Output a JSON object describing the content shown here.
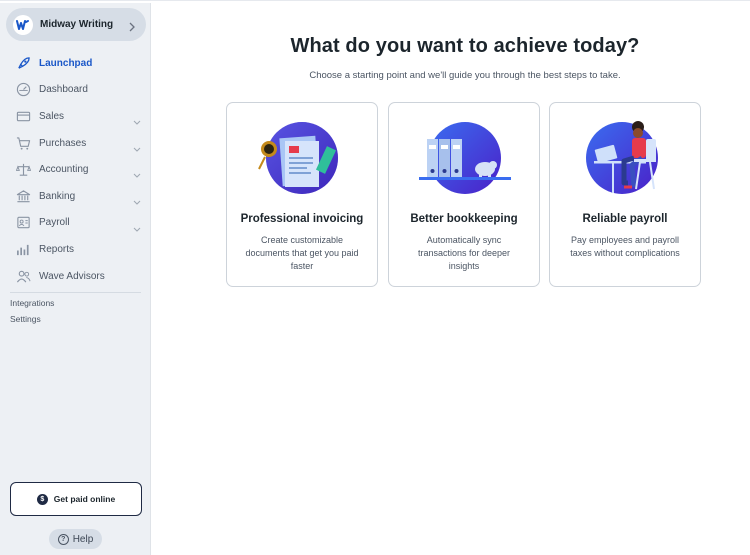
{
  "sidebar": {
    "business_name": "Midway Writing",
    "nav": [
      {
        "label": "Launchpad",
        "icon": "rocket-icon",
        "active": true,
        "caret": false
      },
      {
        "label": "Dashboard",
        "icon": "dashboard-icon",
        "active": false,
        "caret": false
      },
      {
        "label": "Sales",
        "icon": "sales-icon",
        "active": false,
        "caret": true
      },
      {
        "label": "Purchases",
        "icon": "purchases-icon",
        "active": false,
        "caret": true
      },
      {
        "label": "Accounting",
        "icon": "scales-icon",
        "active": false,
        "caret": true
      },
      {
        "label": "Banking",
        "icon": "bank-icon",
        "active": false,
        "caret": true
      },
      {
        "label": "Payroll",
        "icon": "payroll-icon",
        "active": false,
        "caret": true
      },
      {
        "label": "Reports",
        "icon": "bar-chart-icon",
        "active": false,
        "caret": false
      },
      {
        "label": "Wave Advisors",
        "icon": "advisors-icon",
        "active": false,
        "caret": false
      }
    ],
    "integrations": "Integrations",
    "settings": "Settings",
    "get_paid": "Get paid online",
    "help": "Help"
  },
  "main": {
    "heading": "What do you want to achieve today?",
    "subheading": "Choose a starting point and we'll guide you through the best steps to take.",
    "cards": [
      {
        "title": "Professional invoicing",
        "description": "Create customizable documents that get you paid faster"
      },
      {
        "title": "Better bookkeeping",
        "description": "Automatically sync transactions for deeper insights"
      },
      {
        "title": "Reliable payroll",
        "description": "Pay employees and payroll taxes without complications"
      }
    ]
  },
  "colors": {
    "accent": "#1a57c8",
    "sidebar_bg": "#edf0f4",
    "illustration_purple": "#4b2fd0"
  }
}
